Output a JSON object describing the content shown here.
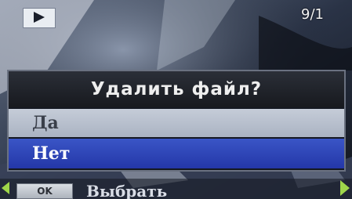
{
  "status_bar": {
    "mode_icon": "play-icon",
    "counter": "9/1"
  },
  "dialog": {
    "title": "Удалить файл?",
    "options": [
      {
        "label": "Да",
        "selected": false
      },
      {
        "label": "Нет",
        "selected": true
      }
    ]
  },
  "bottom_bar": {
    "ok_key": "OK",
    "hint": "Выбрать",
    "nav_arrow_color": "#9fd64a"
  },
  "colors": {
    "highlight": "#2b40b4",
    "option_bg": "#b8c0cd"
  }
}
